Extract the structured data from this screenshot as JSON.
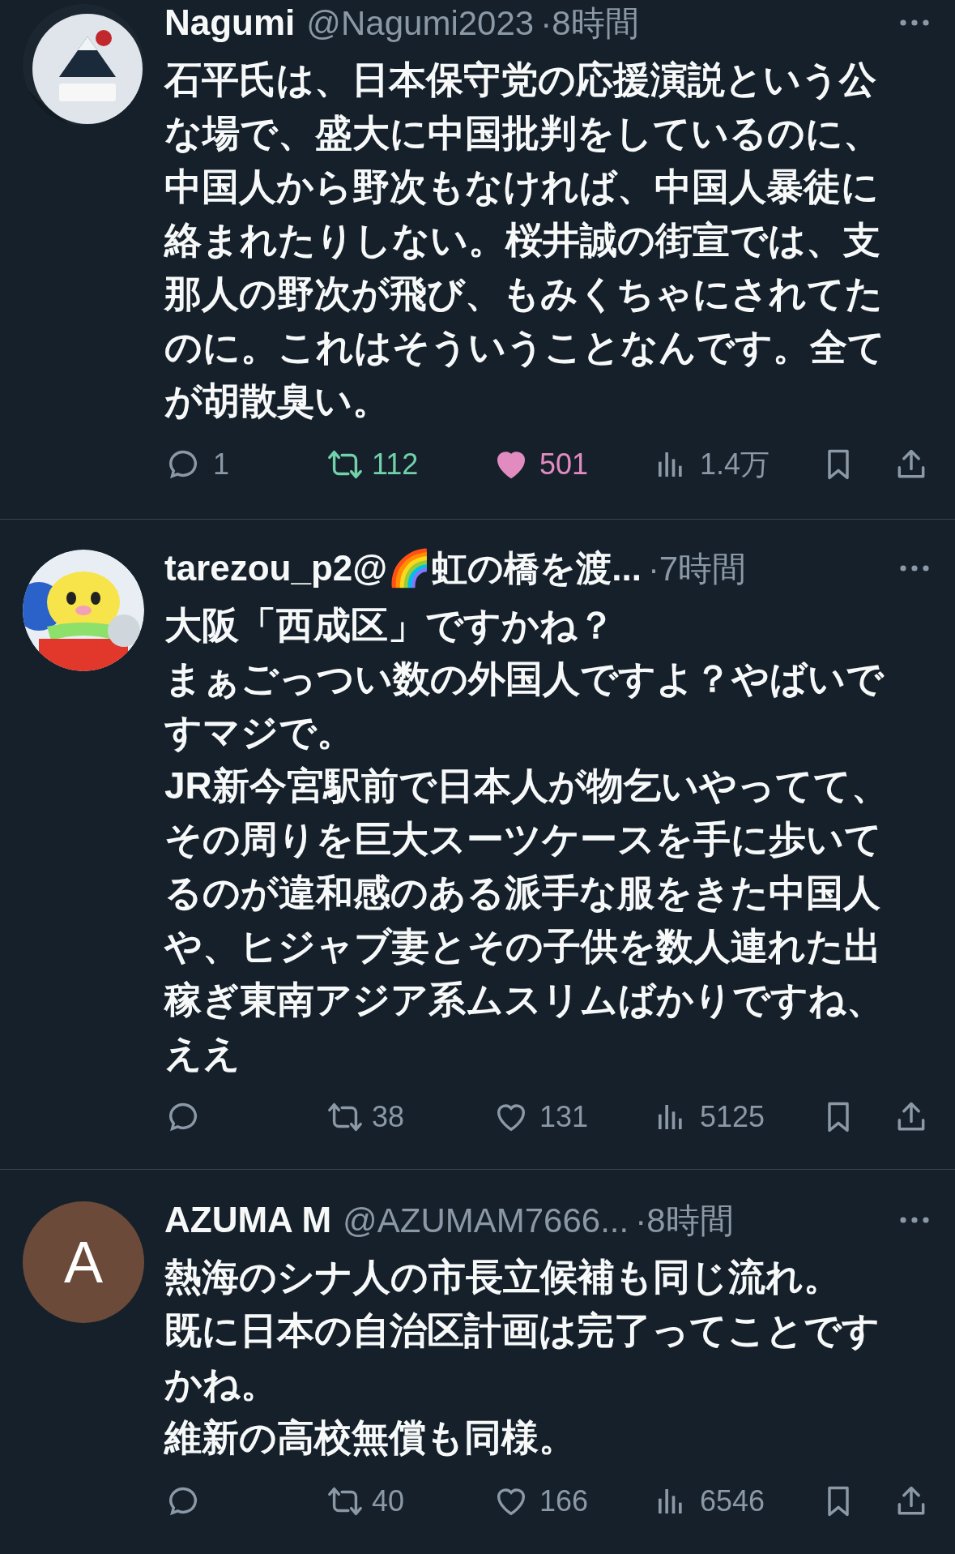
{
  "tweets": [
    {
      "name": "Nagumi",
      "handle": "@Nagumi2023",
      "time": "·8時間",
      "body": [
        "石平氏は、日本保守党の応援演説という公な場で、盛大に中国批判をしているのに、中国人から野次もなければ、中国人暴徒に絡まれたりしない。桜井誠の街宣では、支那人の野次が飛び、もみくちゃにされてたのに。これはそういうことなんです。全てが胡散臭い。"
      ],
      "replies": "1",
      "reposts": "112",
      "reposted": true,
      "likes": "501",
      "liked": true,
      "views": "1.4万"
    },
    {
      "name": "tarezou_p2@🌈虹の橋を渡...",
      "time": "·7時間",
      "body": [
        "大阪「西成区」ですかね？",
        "まぁごっつい数の外国人ですよ？やばいですマジで。",
        "JR新今宮駅前で日本人が物乞いやってて、その周りを巨大スーツケースを手に歩いてるのが違和感のある派手な服をきた中国人や、ヒジャブ妻とその子供を数人連れた出稼ぎ東南アジア系ムスリムばかりですね、ええ"
      ],
      "reposts": "38",
      "reposted": false,
      "likes": "131",
      "liked": false,
      "views": "5125"
    },
    {
      "avatar": {
        "kind": "letter",
        "letter": "A",
        "color": "#6b4a3a"
      },
      "name": "AZUMA M",
      "handle": "@AZUMAM7666...",
      "time": "·8時間",
      "body": [
        "熱海のシナ人の市長立候補も同じ流れ。",
        "既に日本の自治区計画は完了ってことですかね。",
        "維新の高校無償も同様。"
      ],
      "reposts": "40",
      "reposted": false,
      "likes": "166",
      "liked": false,
      "views": "6546"
    }
  ]
}
